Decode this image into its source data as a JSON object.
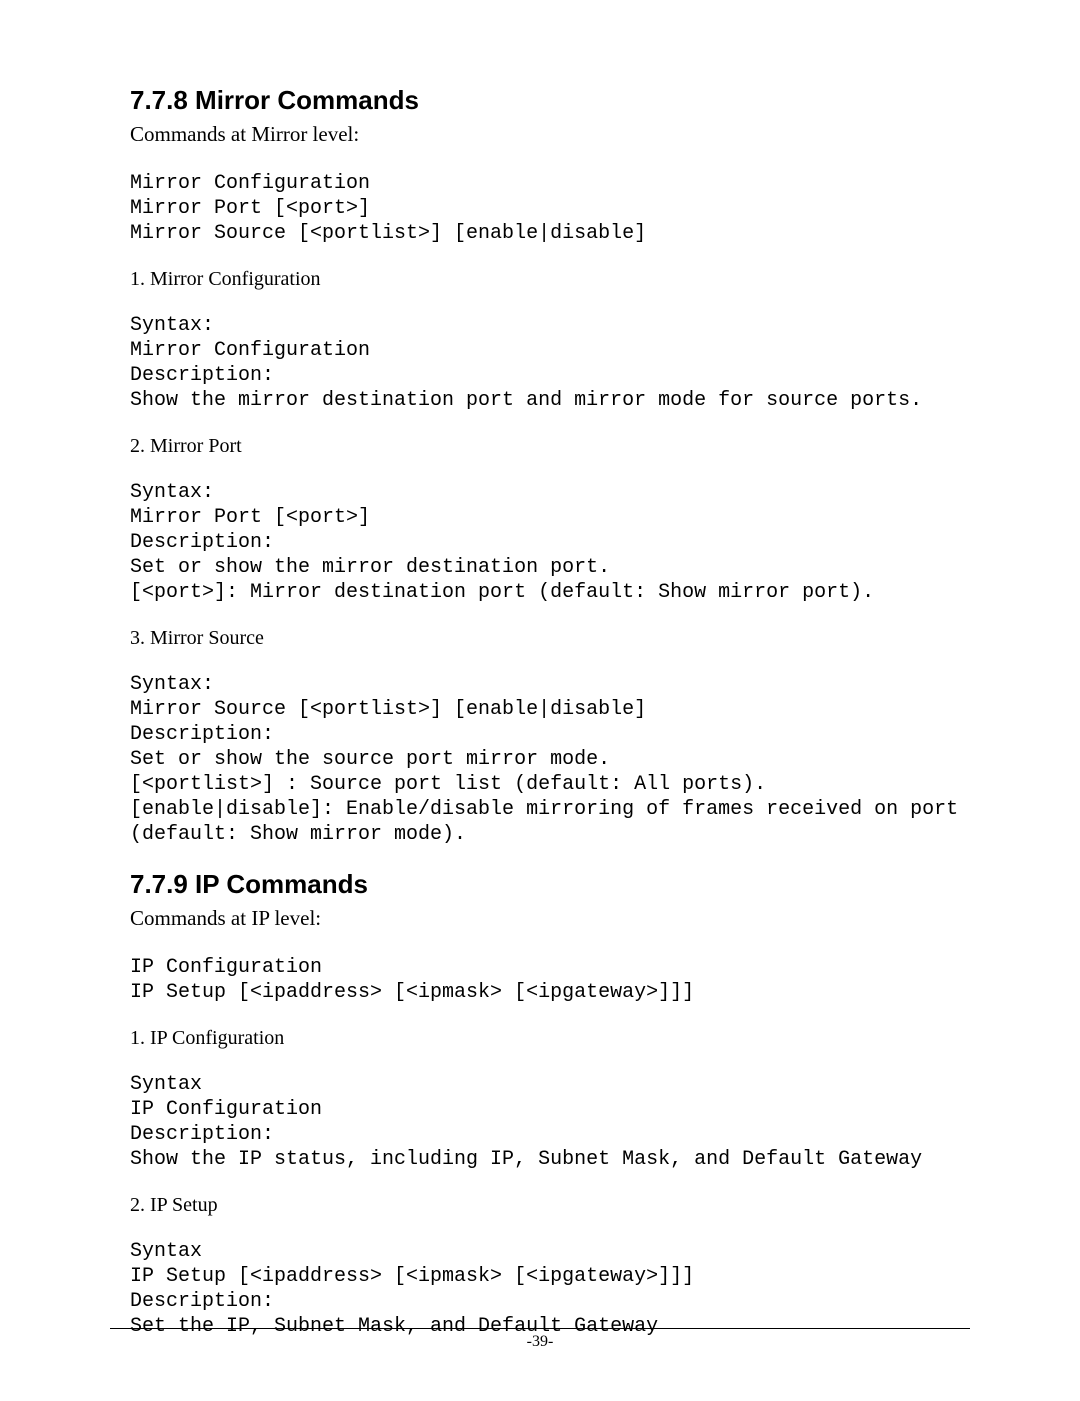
{
  "section778": {
    "heading": "7.7.8 Mirror Commands",
    "intro": "Commands at Mirror level:",
    "commandList": "Mirror Configuration\nMirror Port [<port>]\nMirror Source [<portlist>] [enable|disable]",
    "items": [
      {
        "title": "1.  Mirror Configuration",
        "code": "Syntax:\nMirror Configuration\nDescription:\nShow the mirror destination port and mirror mode for source ports."
      },
      {
        "title": "2.  Mirror Port",
        "code": "Syntax:\nMirror Port [<port>]\nDescription:\nSet or show the mirror destination port.\n[<port>]: Mirror destination port (default: Show mirror port)."
      },
      {
        "title": "3.  Mirror Source",
        "code": "Syntax:\nMirror Source [<portlist>] [enable|disable]\nDescription:\nSet or show the source port mirror mode.\n[<portlist>] : Source port list (default: All ports).\n[enable|disable]: Enable/disable mirroring of frames received on port\n(default: Show mirror mode)."
      }
    ]
  },
  "section779": {
    "heading": "7.7.9 IP Commands",
    "intro": "Commands at IP level:",
    "commandList": "IP Configuration\nIP Setup [<ipaddress> [<ipmask> [<ipgateway>]]]",
    "items": [
      {
        "title": "1.  IP Configuration",
        "code": "Syntax\nIP Configuration\nDescription:\nShow the IP status, including IP, Subnet Mask, and Default Gateway"
      },
      {
        "title": "2.  IP Setup",
        "code": "Syntax\nIP Setup [<ipaddress> [<ipmask> [<ipgateway>]]]\nDescription:\nSet the IP, Subnet Mask, and Default Gateway"
      }
    ]
  },
  "pageNumber": "-39-"
}
